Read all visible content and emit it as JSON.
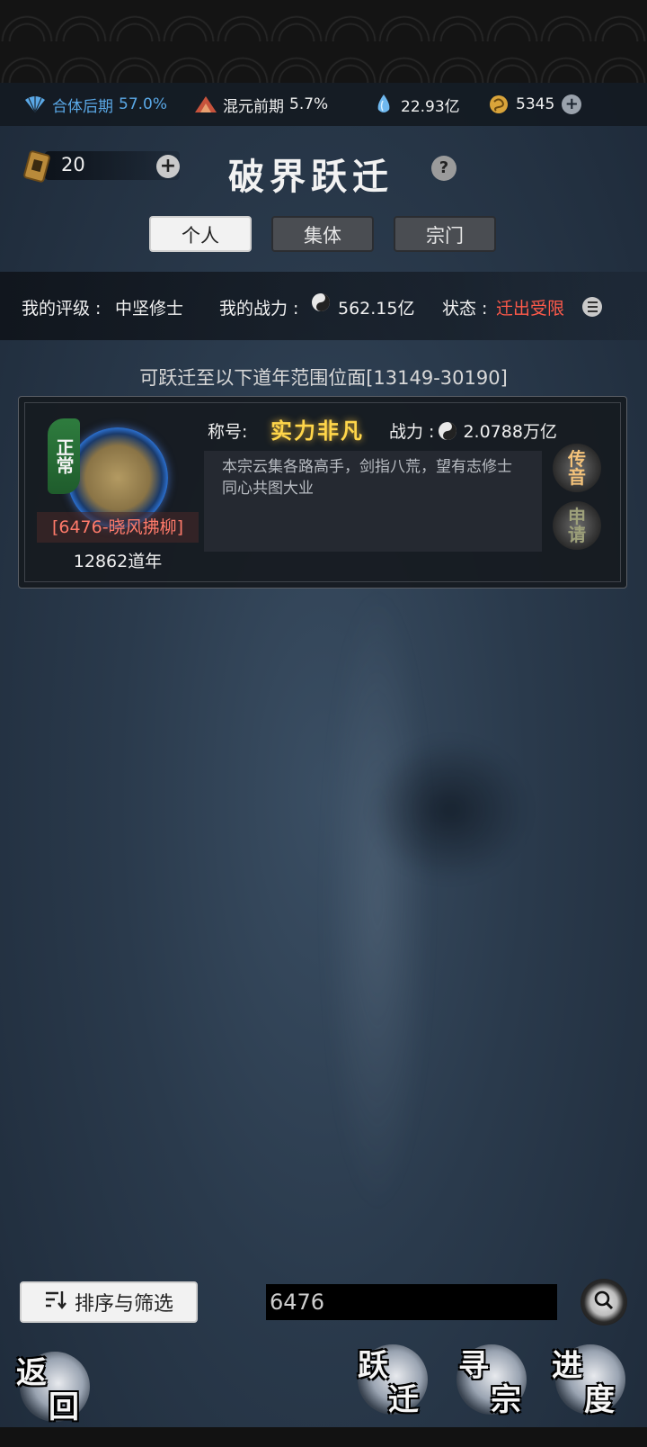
{
  "status": {
    "cultivation": {
      "stage": "合体后期",
      "percent": "57.0%"
    },
    "realm": {
      "stage": "混元前期",
      "percent": "5.7%"
    },
    "spirit_stones": "22.93亿",
    "gold": "5345"
  },
  "header": {
    "token_count": "20",
    "title": "破界跃迁",
    "help": "?"
  },
  "tabs": [
    {
      "label": "个人",
      "active": true
    },
    {
      "label": "集体",
      "active": false
    },
    {
      "label": "宗门",
      "active": false
    }
  ],
  "info": {
    "rating_label": "我的评级 : ",
    "rating_value": "中坚修士",
    "power_label": "我的战力 : ",
    "power_value": "562.15亿",
    "state_label": "状态 : ",
    "state_value": "迁出受限"
  },
  "range_text": "可跃迁至以下道年范围位面[13149-30190]",
  "sect_card": {
    "status": "正常",
    "name": "[6476-晓风拂柳]",
    "years": "12862道年",
    "title_label": "称号:",
    "title_value": "实力非凡",
    "power_label": "战力 : ",
    "power_value": "2.0788万亿",
    "motto": "本宗云集各路高手，剑指八荒，望有志修士同心共图大业",
    "message_button": [
      "传",
      "音"
    ],
    "apply_button": [
      "申",
      "请"
    ]
  },
  "controls": {
    "sort_label": "排序与筛选",
    "search_value": "6476"
  },
  "nav": {
    "back": [
      "返",
      "回"
    ],
    "migrate": [
      "跃",
      "迁"
    ],
    "find_sect": [
      "寻",
      "宗"
    ],
    "progress": [
      "进",
      "度"
    ]
  },
  "colors": {
    "accent_blue": "#5aa8e6",
    "warning_red": "#ff5a4a",
    "title_gold": "#ffd64a",
    "badge_green": "#2e7c3e"
  }
}
